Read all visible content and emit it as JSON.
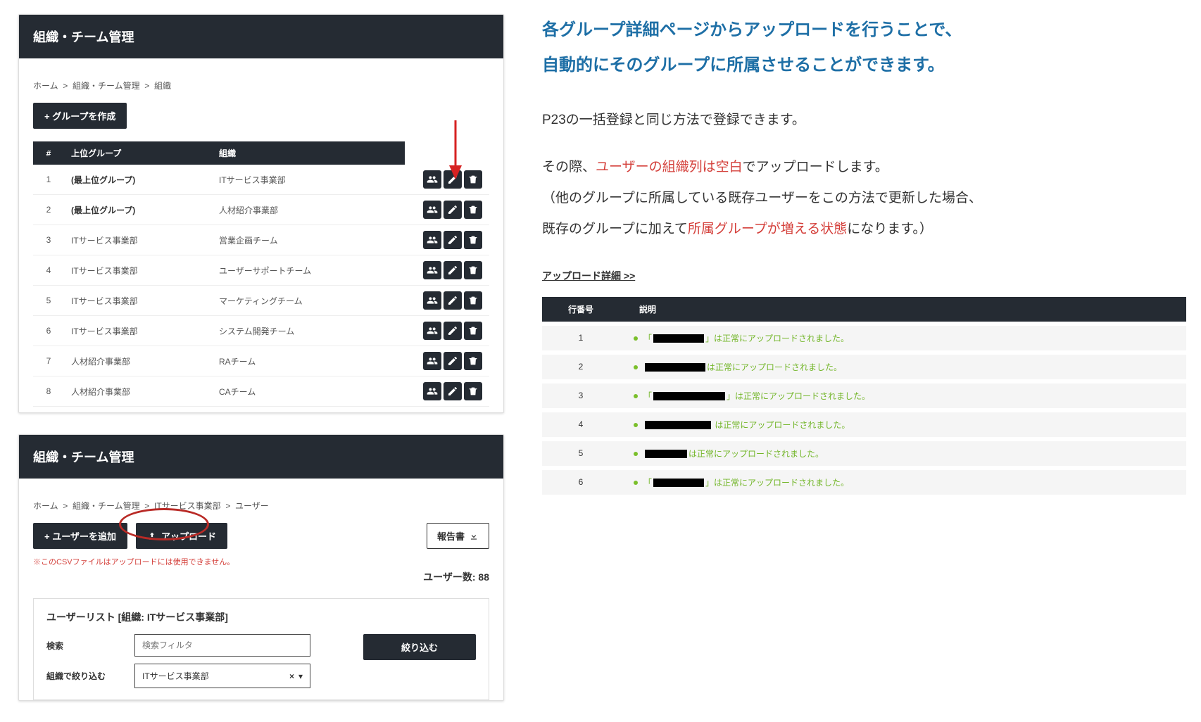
{
  "panel1": {
    "title": "組織・チーム管理",
    "breadcrumb": [
      "ホーム",
      "組織・チーム管理",
      "組織"
    ],
    "create_btn": "+ グループを作成",
    "table": {
      "headers": {
        "num": "#",
        "parent": "上位グループ",
        "org": "組織"
      },
      "rows": [
        {
          "n": "1",
          "parent": "(最上位グループ)",
          "org": "ITサービス事業部",
          "bold": true
        },
        {
          "n": "2",
          "parent": "(最上位グループ)",
          "org": "人材紹介事業部",
          "bold": true
        },
        {
          "n": "3",
          "parent": "ITサービス事業部",
          "org": "営業企画チーム"
        },
        {
          "n": "4",
          "parent": "ITサービス事業部",
          "org": "ユーザーサポートチーム"
        },
        {
          "n": "5",
          "parent": "ITサービス事業部",
          "org": "マーケティングチーム"
        },
        {
          "n": "6",
          "parent": "ITサービス事業部",
          "org": "システム開発チーム"
        },
        {
          "n": "7",
          "parent": "人材紹介事業部",
          "org": "RAチーム"
        },
        {
          "n": "8",
          "parent": "人材紹介事業部",
          "org": "CAチーム"
        }
      ]
    }
  },
  "panel2": {
    "title": "組織・チーム管理",
    "breadcrumb": [
      "ホーム",
      "組織・チーム管理",
      "ITサービス事業部",
      "ユーザー"
    ],
    "add_user_btn": "+ ユーザーを追加",
    "upload_btn": "アップロード",
    "report_btn": "報告書",
    "csv_note": "※このCSVファイルはアップロードには使用できません。",
    "user_count_label": "ユーザー数: ",
    "user_count_value": "88",
    "list_title": "ユーザーリスト [組織: ITサービス事業部]",
    "search_label": "検索",
    "search_placeholder": "検索フィルタ",
    "org_filter_label": "組織で絞り込む",
    "org_filter_value": "ITサービス事業部",
    "filter_btn": "絞り込む"
  },
  "right": {
    "headline1": "各グループ詳細ページからアップロードを行うことで、",
    "headline2": "自動的にそのグループに所属させることができます。",
    "body1": "P23の一括登録と同じ方法で登録できます。",
    "body2a": "その際、",
    "body2b": "ユーザーの組織列は空白",
    "body2c": "でアップロードします。",
    "body3a": "（他のグループに所属している既存ユーザーをこの方法で更新した場合、",
    "body3b": "既存のグループに加えて",
    "body3c": "所属グループが増える状態",
    "body3d": "になります。）"
  },
  "upload_detail": {
    "title": "アップロード詳細 >>",
    "headers": {
      "row": "行番号",
      "desc": "説明"
    },
    "rows": [
      {
        "n": "1",
        "pre": "「",
        "bw": 72,
        "post": "」は正常にアップロードされました。"
      },
      {
        "n": "2",
        "pre": "",
        "bw": 86,
        "post": "は正常にアップロードされました。"
      },
      {
        "n": "3",
        "pre": "「",
        "bw": 102,
        "post": "」は正常にアップロードされました。"
      },
      {
        "n": "4",
        "pre": "",
        "bw": 94,
        "post": " は正常にアップロードされました。"
      },
      {
        "n": "5",
        "pre": "",
        "bw": 60,
        "post": "は正常にアップロードされました。"
      },
      {
        "n": "6",
        "pre": "「",
        "bw": 72,
        "post": "」は正常にアップロードされました。"
      }
    ]
  }
}
